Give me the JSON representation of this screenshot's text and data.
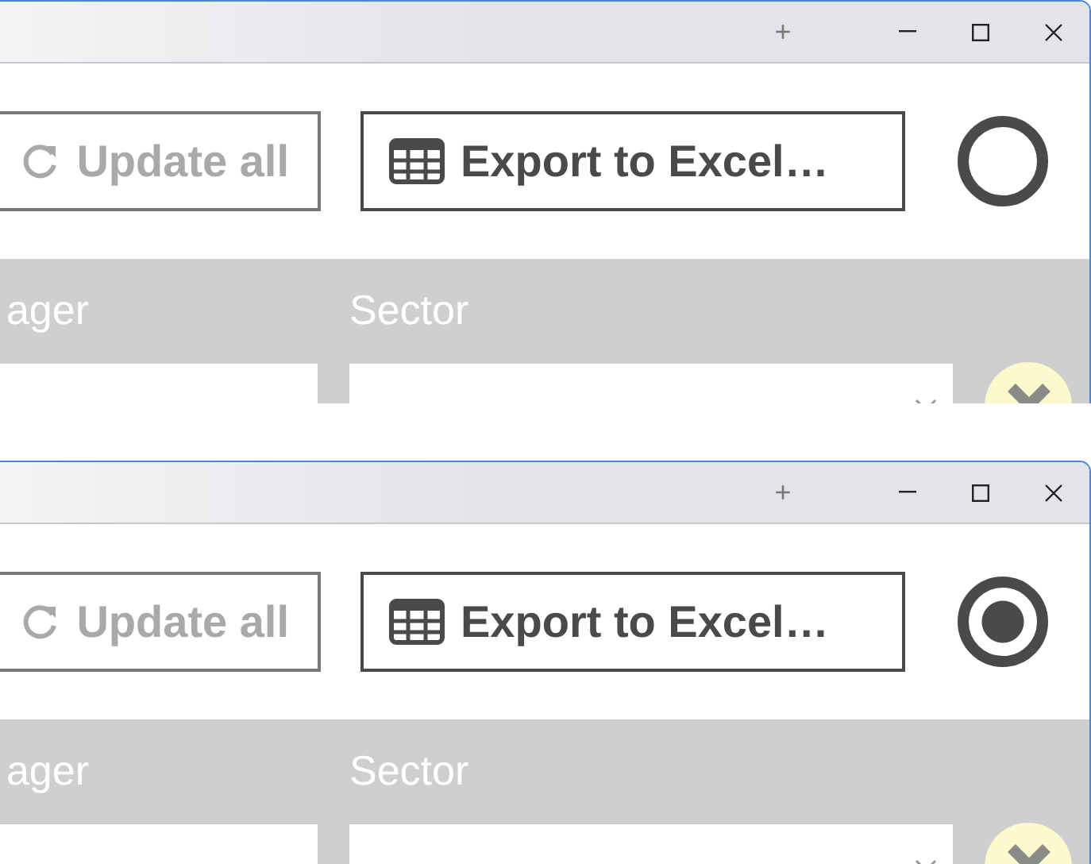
{
  "windows": [
    {
      "title_bar": {
        "new_tab": "+"
      },
      "toolbar": {
        "buttons": [
          {
            "label": "Update all",
            "disabled": true,
            "kind": "refresh"
          },
          {
            "label": "Export to Excel…",
            "disabled": false,
            "kind": "table"
          }
        ],
        "toggle": {
          "selected": false
        }
      },
      "filters": [
        {
          "label": "ager",
          "kind": "text"
        },
        {
          "label": "Sector",
          "kind": "dropdown"
        }
      ]
    },
    {
      "title_bar": {
        "new_tab": "+"
      },
      "toolbar": {
        "buttons": [
          {
            "label": "Update all",
            "disabled": true,
            "kind": "refresh"
          },
          {
            "label": "Export to Excel…",
            "disabled": false,
            "kind": "table"
          }
        ],
        "toggle": {
          "selected": true
        }
      },
      "filters": [
        {
          "label": "ager",
          "kind": "text"
        },
        {
          "label": "Sector",
          "kind": "dropdown"
        }
      ]
    }
  ]
}
